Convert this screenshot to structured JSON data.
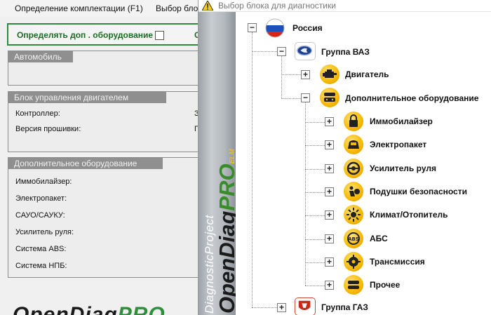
{
  "background": {
    "menu": [
      "Определение комплектации (F1)",
      "Выбор блок"
    ],
    "option_label": "Определять доп . оборудование",
    "option_extra": "С",
    "car_group_title": "Автомобиль",
    "ecu_group_title": "Блок управления двигателем",
    "ecu_rows": [
      "Контроллер:",
      "Версия прошивки:"
    ],
    "ecu_values": [
      "З",
      "П"
    ],
    "extra_group_title": "Дополнительное оборудование",
    "extra_rows": [
      "Иммобилайзер:",
      "Электропакет:",
      "САУО/САУКУ:",
      "Усилитель руля:",
      "Система ABS:",
      "Система НПБ:"
    ],
    "logo_bottom_a": "OpenDiag",
    "logo_bottom_b": "PRO"
  },
  "popup": {
    "title": "Выбор блока для диагностики",
    "brand_small": "DiagnosticProject",
    "brand_big_a": "OpenDiag",
    "brand_big_b": "PRO",
    "brand_elm": "ELM"
  },
  "tree": {
    "root": {
      "label": "Россия",
      "expander": "−",
      "icon": "russia-flag-icon"
    },
    "groups": [
      {
        "label": "Группа ВАЗ",
        "expander": "−",
        "icon": "lada-logo-icon"
      },
      {
        "label": "Группа ГАЗ",
        "expander": "+",
        "icon": "gaz-logo-icon"
      }
    ],
    "vaz_children": [
      {
        "label": "Двигатель",
        "expander": "+",
        "icon": "engine-icon"
      },
      {
        "label": "Дополнительное оборудование",
        "expander": "−",
        "icon": "equipment-icon"
      }
    ],
    "equipment_children": [
      {
        "label": "Иммобилайзер",
        "expander": "+",
        "icon": "lock-icon"
      },
      {
        "label": "Электропакет",
        "expander": "+",
        "icon": "car-window-icon"
      },
      {
        "label": "Усилитель руля",
        "expander": "+",
        "icon": "steering-wheel-icon"
      },
      {
        "label": "Подушки безопасности",
        "expander": "+",
        "icon": "airbag-icon"
      },
      {
        "label": "Климат/Отопитель",
        "expander": "+",
        "icon": "climate-icon"
      },
      {
        "label": "АБС",
        "expander": "+",
        "icon": "abs-icon"
      },
      {
        "label": "Трансмиссия",
        "expander": "+",
        "icon": "transmission-icon"
      },
      {
        "label": "Прочее",
        "expander": "+",
        "icon": "other-icon"
      }
    ]
  }
}
